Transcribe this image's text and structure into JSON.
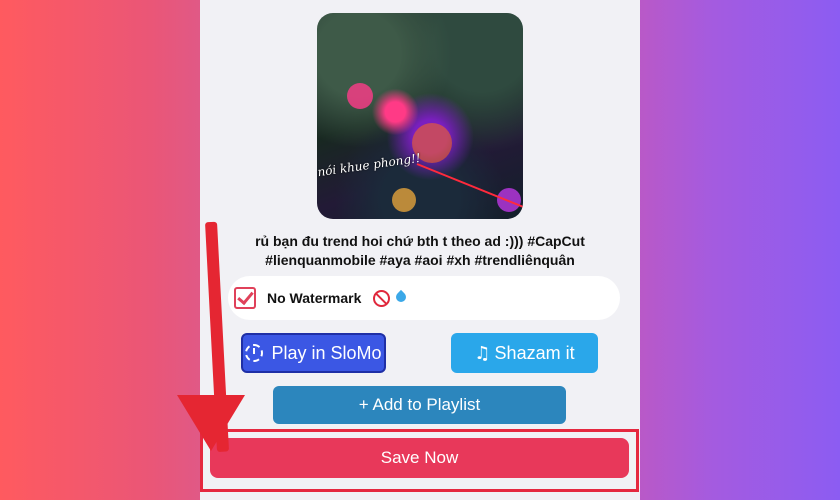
{
  "video": {
    "caption": "nói khue phong!!",
    "description": "rủ bạn đu trend hoi chứ bth t theo ad :))) #CapCut #lienquanmobile #aya #aoi #xh #trendliênquân"
  },
  "options": {
    "no_watermark_label": "No Watermark",
    "no_watermark_checked": true
  },
  "buttons": {
    "slomo_label": "Play in SloMo",
    "shazam_label": "Shazam it",
    "playlist_label": "+ Add to Playlist",
    "save_label": "Save Now"
  },
  "colors": {
    "save": "#e8385a",
    "highlight": "#e5283f",
    "slomo": "#3b57e4",
    "shazam": "#2aa7ea",
    "playlist": "#2c86bd"
  },
  "icons": {
    "checkbox": "checkbox-checked-icon",
    "no": "prohibited-icon",
    "drop": "droplet-icon",
    "slomo": "slow-motion-icon",
    "shazam": "music-note-icon",
    "arrow": "down-arrow-annotation"
  }
}
